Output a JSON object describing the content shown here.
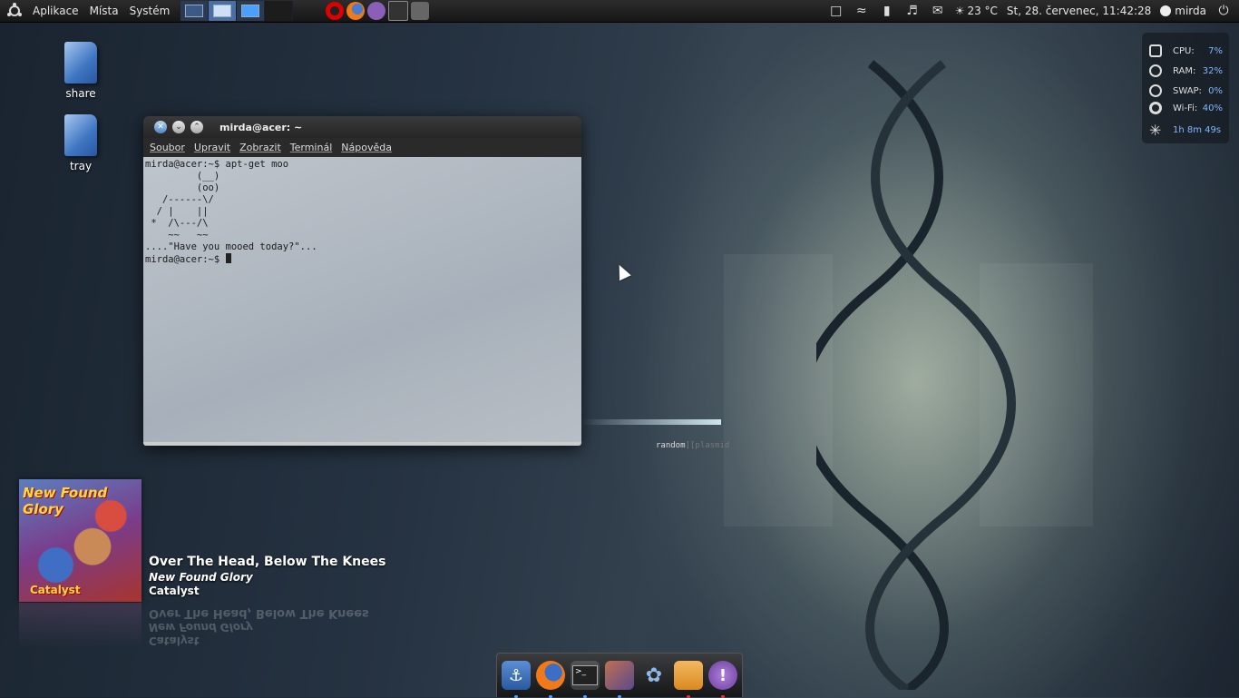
{
  "top_panel": {
    "menus": [
      "Aplikace",
      "Místa",
      "Systém"
    ],
    "weather": "23 °C",
    "clock": "St, 28. červenec, 11:42:28",
    "user": "mirda",
    "icons": [
      "ubuntu-logo",
      "opera",
      "firefox",
      "pidgin",
      "terminal",
      "screenshot",
      "chat",
      "wifi",
      "network",
      "volume",
      "mail",
      "weather",
      "user",
      "power"
    ]
  },
  "desktop": {
    "icons": [
      {
        "label": "share"
      },
      {
        "label": "tray"
      }
    ]
  },
  "terminal": {
    "title": "mirda@acer: ~",
    "menu": [
      "Soubor",
      "Upravit",
      "Zobrazit",
      "Terminál",
      "Nápověda"
    ],
    "content": "mirda@acer:~$ apt-get moo\n         (__)\n         (oo)\n   /------\\/\n  / |    ||\n *  /\\---/\\\n    ~~   ~~\n....\"Have you mooed today?\"...\nmirda@acer:~$ ",
    "accent": "#4f86c6"
  },
  "sysmon": {
    "rows": [
      {
        "label": "CPU:",
        "value": "7%"
      },
      {
        "label": "RAM:",
        "value": "32%"
      },
      {
        "label": "SWAP:",
        "value": "0%"
      },
      {
        "label": "Wi-Fi:",
        "value": "40%"
      }
    ],
    "uptime": "1h 8m 49s",
    "value_color": "#7fb8ff"
  },
  "plasma": {
    "prefix": "random",
    "suffix": "][plasmid"
  },
  "now_playing": {
    "cover_title": "New Found Glory",
    "cover_sub": "Catalyst",
    "song": "Over The Head, Below The Knees",
    "artist": "New Found Glory",
    "album": "Catalyst"
  },
  "dock": {
    "items": [
      "anchor-icon",
      "firefox-icon",
      "terminal-icon",
      "photo-icon",
      "chat-bubbles-icon",
      "home-folder-icon",
      "pidgin-icon"
    ]
  }
}
